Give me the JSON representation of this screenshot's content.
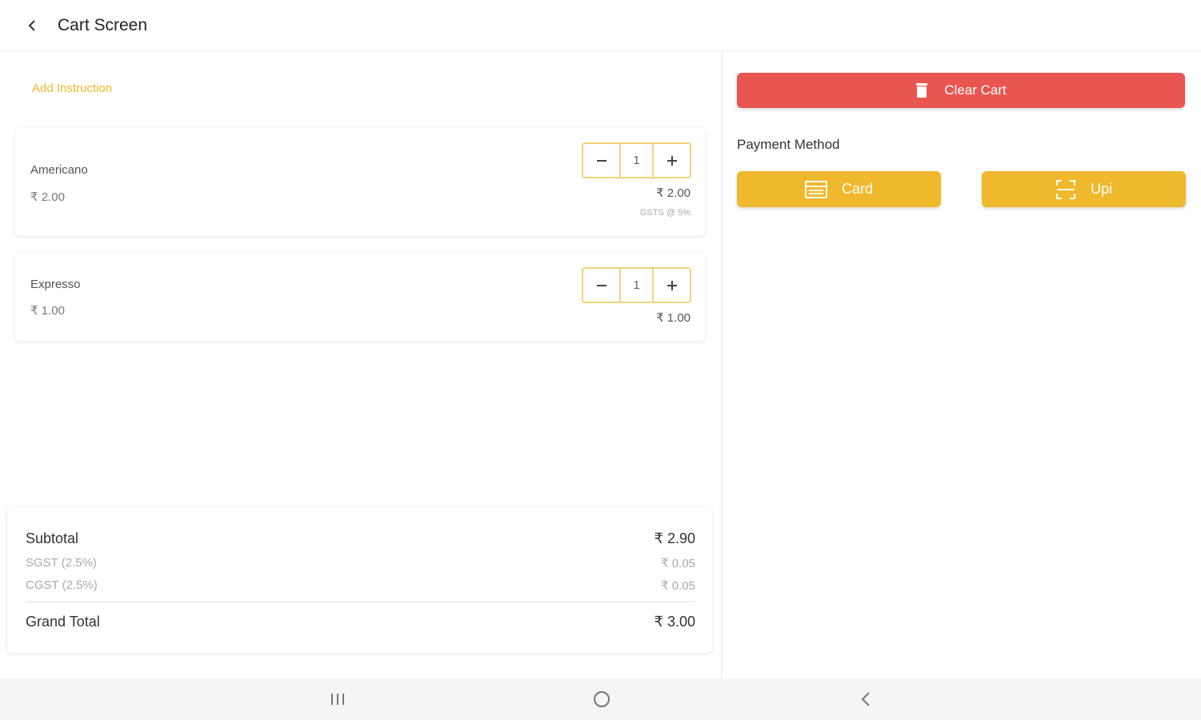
{
  "appbar": {
    "title": "Cart Screen"
  },
  "cart": {
    "add_instruction": "Add Instruction",
    "items": [
      {
        "name": "Americano",
        "price": "₹ 2.00",
        "qty": "1",
        "line_total": "₹ 2.00",
        "tax_note": "GSTS @ 5%"
      },
      {
        "name": "Expresso",
        "price": "₹ 1.00",
        "qty": "1",
        "line_total": "₹ 1.00"
      }
    ]
  },
  "summary": {
    "subtotal_label": "Subtotal",
    "subtotal_value": "₹ 2.90",
    "sgst_label": "SGST (2.5%)",
    "sgst_value": "₹ 0.05",
    "cgst_label": "CGST (2.5%)",
    "cgst_value": "₹ 0.05",
    "grand_label": "Grand Total",
    "grand_value": "₹ 3.00"
  },
  "actions": {
    "clear_cart": "Clear Cart",
    "payment_method_label": "Payment Method",
    "card": "Card",
    "upi": "Upi"
  },
  "colors": {
    "accent_yellow": "#f0b82c",
    "danger_red": "#e95651",
    "instruction_text": "#f0b72a"
  },
  "icons": {
    "back": "chevron-left-icon",
    "stepper_minus": "minus-icon",
    "stepper_plus": "plus-icon",
    "clear_cart": "trash-icon",
    "card": "credit-card-icon",
    "upi": "scan-icon",
    "nav_recent": "recent-apps-icon",
    "nav_home": "home-circle-icon",
    "nav_back": "chevron-left-icon"
  }
}
